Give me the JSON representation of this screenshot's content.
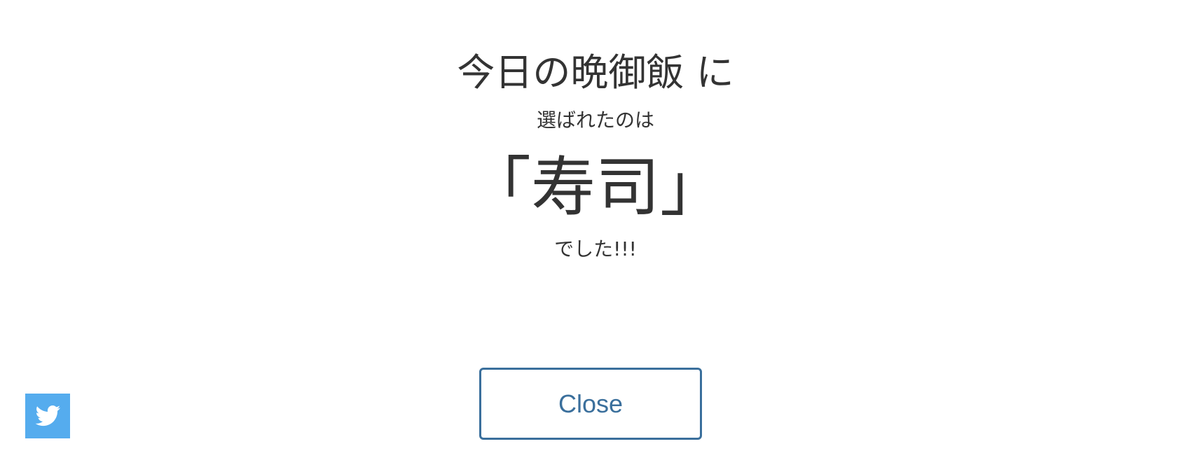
{
  "result_dialog": {
    "title": "今日の晩御飯 に",
    "subtitle": "選ばれたのは",
    "result": "「寿司」",
    "suffix": "でした!!!",
    "close_label": "Close"
  },
  "share": {
    "icon": "twitter-icon",
    "color": "#55acee"
  },
  "colors": {
    "text": "#333333",
    "button_accent": "#3a6f9c",
    "background": "#ffffff"
  }
}
